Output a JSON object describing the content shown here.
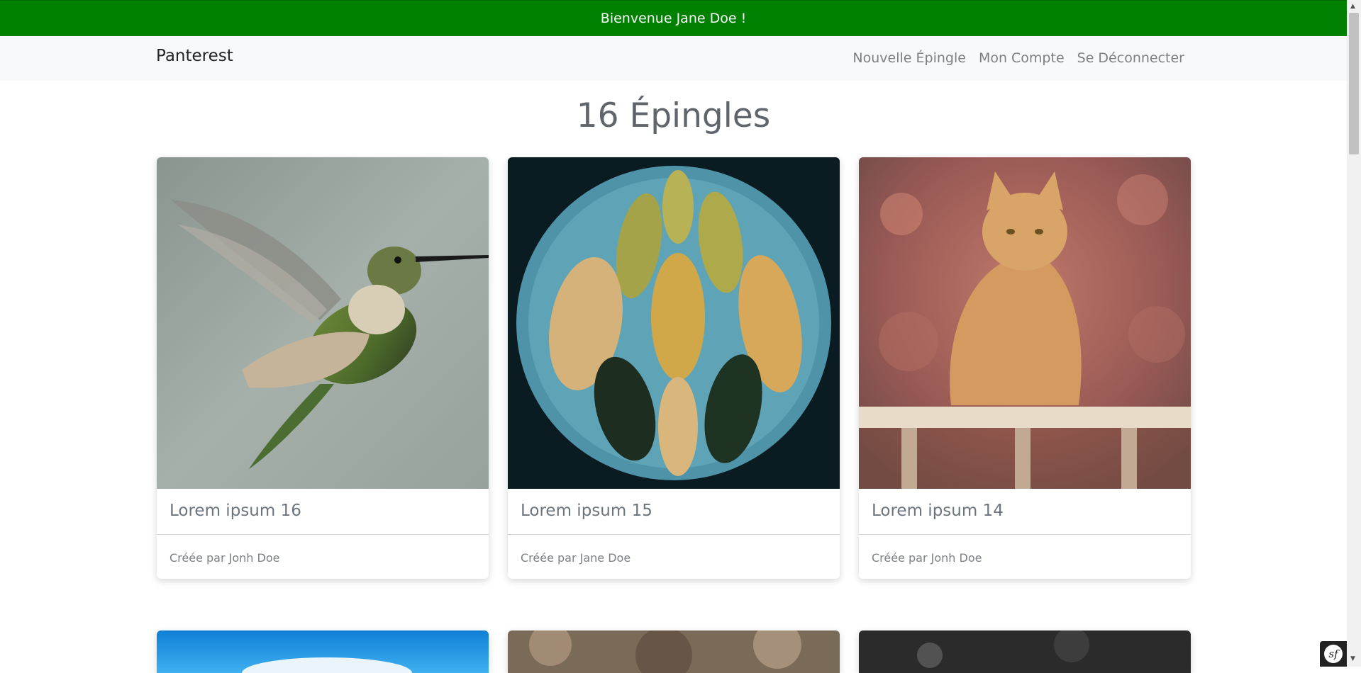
{
  "flash": {
    "message": "Bienvenue Jane Doe !"
  },
  "navbar": {
    "brand": "Panterest",
    "links": [
      "Nouvelle Épingle",
      "Mon Compte",
      "Se Déconnecter"
    ]
  },
  "page": {
    "title": "16 Épingles"
  },
  "pins": [
    {
      "title": "Lorem ipsum 16",
      "author": "Créée par Jonh Doe",
      "image": "hummingbird-photo"
    },
    {
      "title": "Lorem ipsum 15",
      "author": "Créée par Jane Doe",
      "image": "leaves-on-plate-photo"
    },
    {
      "title": "Lorem ipsum 14",
      "author": "Créée par Jonh Doe",
      "image": "orange-cat-photo"
    }
  ],
  "colors": {
    "flash_bg": "#008000",
    "navbar_bg": "#f8f9fa",
    "text_muted": "#6c757d"
  },
  "debug_toolbar": {
    "icon": "symfony-icon",
    "glyph": "sf"
  }
}
